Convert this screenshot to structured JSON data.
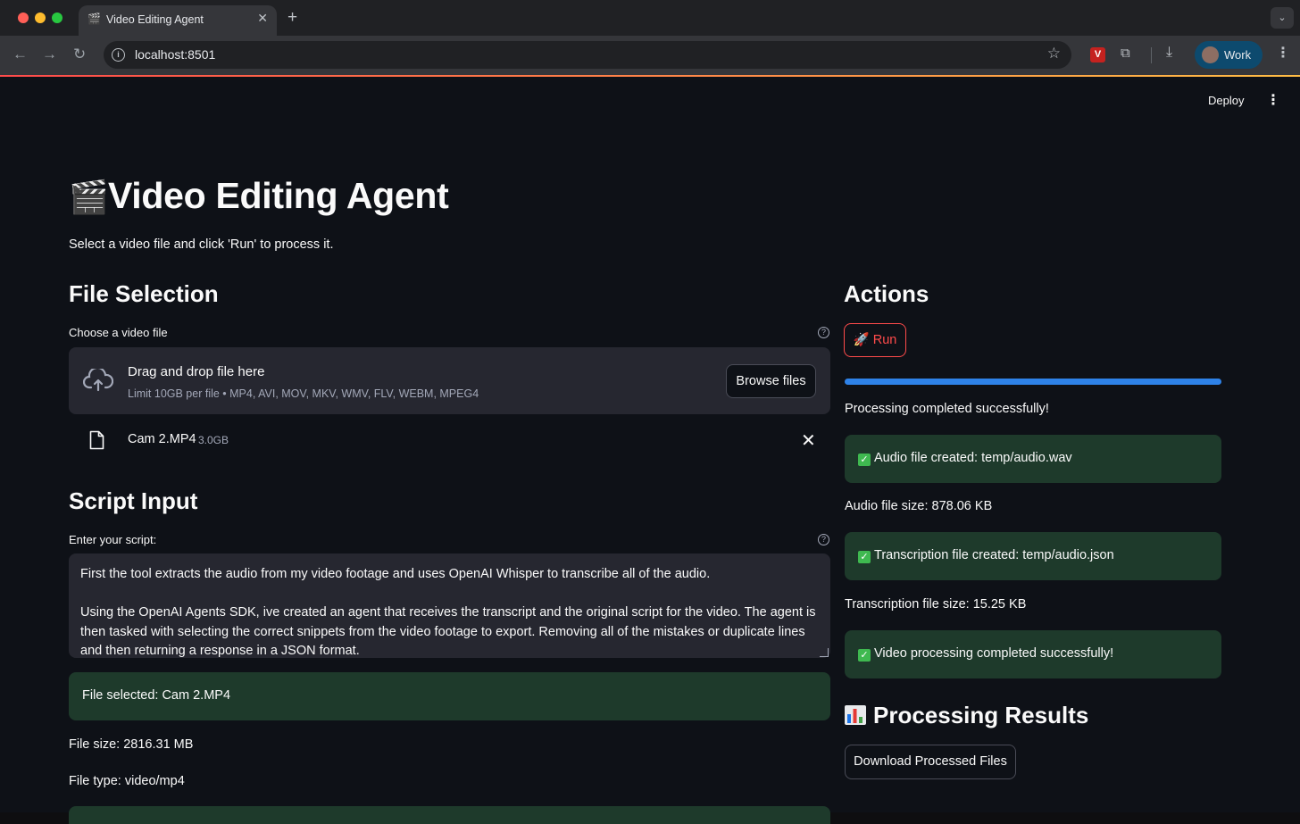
{
  "browser": {
    "tab_title": "Video Editing Agent",
    "tab_favicon": "clapper-icon",
    "url": "localhost:8501",
    "profile_label": "Work"
  },
  "app": {
    "deploy_label": "Deploy",
    "title": "Video Editing Agent",
    "title_icon": "🎬",
    "subtitle": "Select a video file and click 'Run' to process it."
  },
  "file_selection": {
    "heading": "File Selection",
    "label": "Choose a video file",
    "dropzone_title": "Drag and drop file here",
    "dropzone_limit": "Limit 10GB per file • MP4, AVI, MOV, MKV, WMV, FLV, WEBM, MPEG4",
    "browse_label": "Browse files",
    "uploaded_file": {
      "name": "Cam 2.MP4",
      "size": "3.0GB"
    }
  },
  "script_input": {
    "heading": "Script Input",
    "label": "Enter your script:",
    "value": "First the tool extracts the audio from my video footage and uses OpenAI Whisper to transcribe all of the audio.\n\nUsing the OpenAI Agents SDK, ive created an agent that receives the transcript and the original script for the video. The agent is then tasked with selecting the correct snippets from the video footage to export. Removing all of the mistakes or duplicate lines and then returning a response in a JSON format."
  },
  "file_info": {
    "selected": "File selected: Cam 2.MP4",
    "size": "File size: 2816.31 MB",
    "type": "File type: video/mp4"
  },
  "actions": {
    "heading": "Actions",
    "run_label": "Run",
    "run_icon": "🚀",
    "progress": 1.0,
    "status": "Processing completed successfully!",
    "audio_created": "Audio file created: temp/audio.wav",
    "audio_size": "Audio file size: 878.06 KB",
    "transcription_created": "Transcription file created: temp/audio.json",
    "transcription_size": "Transcription file size: 15.25 KB",
    "video_done": "Video processing completed successfully!"
  },
  "results": {
    "heading": "Processing Results",
    "download_label": "Download Processed Files"
  },
  "colors": {
    "accent": "#ff4b4b",
    "progress": "#2e82e8",
    "success_bg": "#1e3a2b",
    "background": "#0e1117"
  }
}
